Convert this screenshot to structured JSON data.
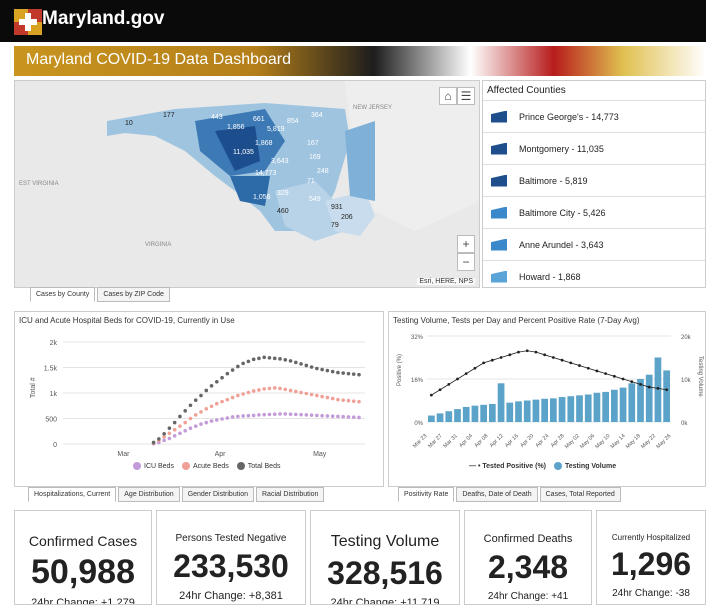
{
  "site": {
    "title": "Maryland.gov"
  },
  "banner": {
    "title": "Maryland COVID-19 Data Dashboard"
  },
  "map": {
    "labels": {
      "nj": "NEW JERSEY",
      "wv": "EST VIRGINIA",
      "va": "VIRGINIA"
    },
    "attribution": "Esri, HERE, NPS",
    "counts": [
      "10",
      "177",
      "443",
      "661",
      "854",
      "364",
      "1,856",
      "5,819",
      "167",
      "1,868",
      "11,035",
      "3,643",
      "169",
      "14,773",
      "248",
      "1,056",
      "329",
      "549",
      "931",
      "460",
      "206",
      "79",
      "71"
    ],
    "controls": {
      "home": "⌂",
      "list": "☰",
      "zoom_in": "+",
      "zoom_out": "−"
    }
  },
  "counties": {
    "title": "Affected Counties",
    "items": [
      "Prince George's - 14,773",
      "Montgomery - 11,035",
      "Baltimore - 5,819",
      "Baltimore City - 5,426",
      "Anne Arundel - 3,643",
      "Howard - 1,868"
    ],
    "colors": [
      "#1f4e8c",
      "#1f4e8c",
      "#1f4e8c",
      "#3a88c9",
      "#3a88c9",
      "#5aa3d6"
    ]
  },
  "map_tabs": [
    "Cases by County",
    "Cases by ZIP Code"
  ],
  "hosp_panel": {
    "title": "ICU and Acute Hospital Beds for COVID-19, Currently in Use",
    "tabs": [
      "Hospitalizations, Current",
      "Age Distribution",
      "Gender Distribution",
      "Racial Distribution"
    ]
  },
  "test_panel": {
    "title": "Testing Volume, Tests per Day and Percent Positive Rate (7-Day Avg)",
    "tabs": [
      "Positivity Rate",
      "Deaths, Date of Death",
      "Cases, Total Reported"
    ]
  },
  "chart_data": [
    {
      "type": "line",
      "title": "ICU and Acute Hospital Beds for COVID-19, Currently in Use",
      "ylabel": "Total #",
      "ylim": [
        0,
        2000
      ],
      "yticks": [
        "2k",
        "1.5k",
        "1k",
        "500",
        "0"
      ],
      "xticks": [
        "Mar",
        "Apr",
        "May"
      ],
      "series": [
        {
          "name": "ICU Beds",
          "color": "#c39bd9",
          "values": [
            5,
            30,
            70,
            110,
            160,
            210,
            260,
            310,
            350,
            390,
            420,
            450,
            470,
            490,
            510,
            530,
            540,
            550,
            555,
            560,
            570,
            575,
            580,
            585,
            590,
            590,
            585,
            580,
            575,
            570,
            565,
            560,
            555,
            550,
            545,
            540,
            535,
            530,
            525,
            520
          ]
        },
        {
          "name": "Acute Beds",
          "color": "#f0a096",
          "values": [
            20,
            70,
            140,
            210,
            280,
            350,
            420,
            500,
            570,
            630,
            690,
            740,
            790,
            830,
            870,
            910,
            950,
            980,
            1010,
            1040,
            1060,
            1080,
            1090,
            1100,
            1090,
            1070,
            1050,
            1030,
            1010,
            990,
            970,
            950,
            930,
            910,
            890,
            870,
            860,
            850,
            840,
            830
          ]
        },
        {
          "name": "Total Beds",
          "color": "#666666",
          "values": [
            30,
            100,
            200,
            310,
            420,
            540,
            650,
            760,
            860,
            950,
            1050,
            1140,
            1220,
            1300,
            1380,
            1450,
            1520,
            1580,
            1620,
            1660,
            1680,
            1700,
            1690,
            1680,
            1670,
            1650,
            1630,
            1600,
            1570,
            1540,
            1510,
            1480,
            1460,
            1440,
            1420,
            1400,
            1390,
            1380,
            1370,
            1360
          ]
        }
      ]
    },
    {
      "type": "bar",
      "title": "Testing Volume, Tests per Day and Percent Positive Rate (7-Day Avg)",
      "ylabel_left": "Positive (%)",
      "ylabel_right": "Testing Volume",
      "yticks_left": [
        "32%",
        "16%",
        "0%"
      ],
      "yticks_right": [
        "20k",
        "10k",
        "0k"
      ],
      "xticks": [
        "Mar 23",
        "Mar 27",
        "Mar 31",
        "Apr 04",
        "Apr 08",
        "Apr 12",
        "Apr 16",
        "Apr 20",
        "Apr 24",
        "Apr 28",
        "May 02",
        "May 06",
        "May 10",
        "May 14",
        "May 18",
        "May 22",
        "May 26"
      ],
      "series": [
        {
          "name": "Tested Positive (%)",
          "color": "#222222",
          "values": [
            10,
            12,
            14,
            16,
            18,
            20,
            22,
            23,
            24,
            25,
            26,
            26.5,
            26,
            25,
            24,
            23,
            22,
            21,
            20,
            19,
            18,
            17,
            16,
            15,
            14,
            13,
            12.5,
            12
          ]
        },
        {
          "name": "Testing Volume",
          "color": "#5ba3c8",
          "values": [
            1500,
            2000,
            2500,
            3000,
            3500,
            3800,
            4000,
            4200,
            9000,
            4500,
            4800,
            5000,
            5200,
            5400,
            5500,
            5800,
            6000,
            6200,
            6400,
            6800,
            7000,
            7500,
            8000,
            9000,
            10000,
            11000,
            15000,
            12000
          ]
        }
      ]
    }
  ],
  "cards": [
    {
      "label": "Confirmed Cases",
      "value": "50,988",
      "change": "24hr Change: +1,279"
    },
    {
      "label": "Persons Tested Negative",
      "value": "233,530",
      "change": "24hr Change: +8,381"
    },
    {
      "label": "Testing Volume",
      "value": "328,516",
      "change": "24hr Change: +11,719"
    },
    {
      "label": "Confirmed Deaths",
      "value": "2,348",
      "change": "24hr Change: +41"
    },
    {
      "label": "Currently Hospitalized",
      "value": "1,296",
      "change": "24hr Change: -38"
    }
  ]
}
